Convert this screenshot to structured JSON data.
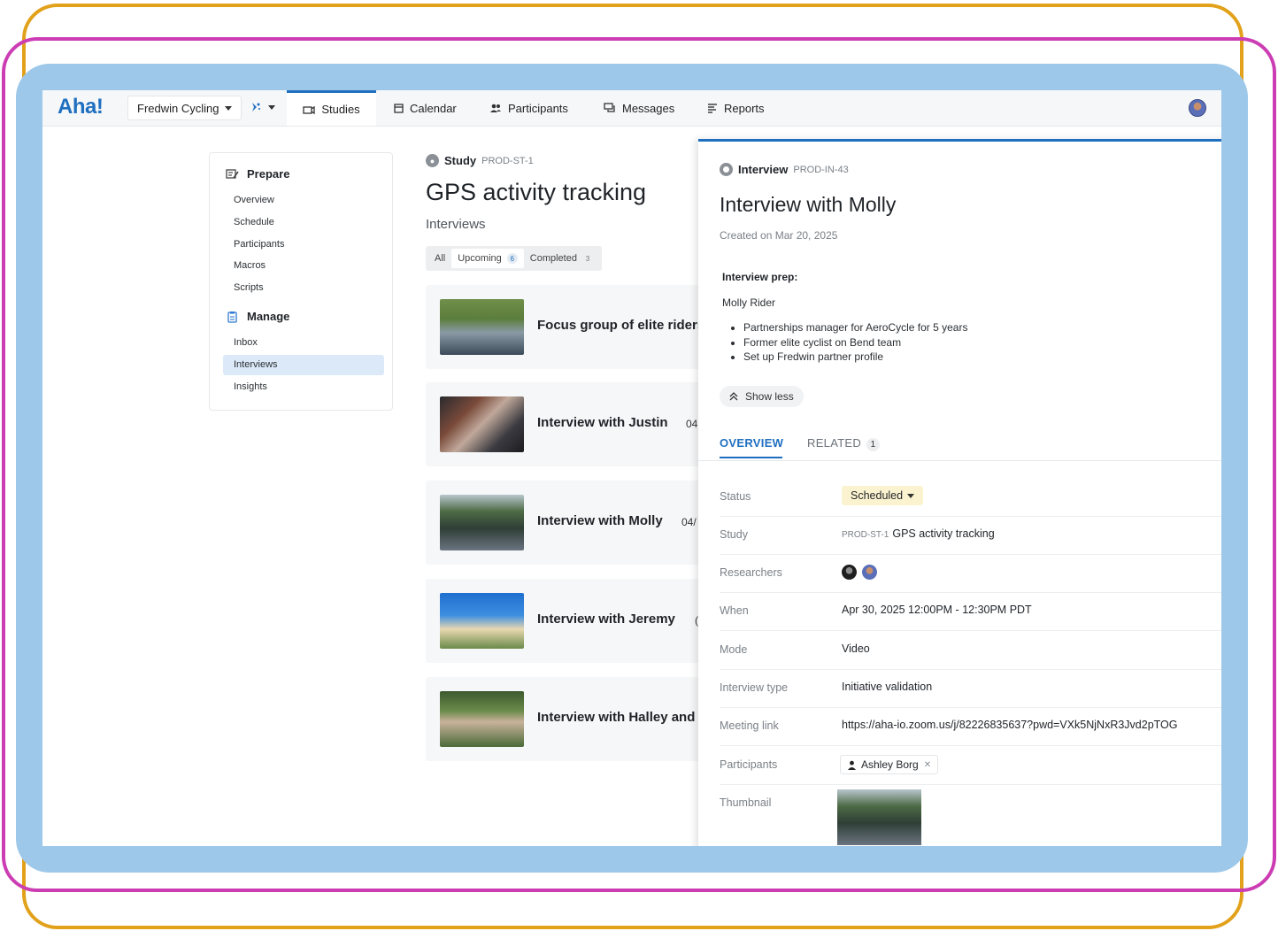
{
  "nav": {
    "logo": "Aha!",
    "workspace": "Fredwin Cycling",
    "tabs": [
      {
        "label": "Studies",
        "icon": "studies-icon",
        "active": true
      },
      {
        "label": "Calendar",
        "icon": "calendar-icon"
      },
      {
        "label": "Participants",
        "icon": "participants-icon"
      },
      {
        "label": "Messages",
        "icon": "messages-icon"
      },
      {
        "label": "Reports",
        "icon": "reports-icon"
      }
    ]
  },
  "sidebar": {
    "prepare": {
      "title": "Prepare",
      "items": [
        "Overview",
        "Schedule",
        "Participants",
        "Macros",
        "Scripts"
      ]
    },
    "manage": {
      "title": "Manage",
      "items": [
        "Inbox",
        "Interviews",
        "Insights"
      ],
      "active": "Interviews"
    }
  },
  "study": {
    "label": "Study",
    "id": "PROD-ST-1",
    "title": "GPS activity tracking",
    "section": "Interviews",
    "filters": {
      "all": "All",
      "upcoming": "Upcoming",
      "upcoming_count": "6",
      "completed": "Completed",
      "completed_count": "3"
    }
  },
  "cards": [
    {
      "title": "Focus group of elite riders",
      "date": ""
    },
    {
      "title": "Interview with Justin",
      "date": "04"
    },
    {
      "title": "Interview with Molly",
      "date": "04/"
    },
    {
      "title": "Interview with Jeremy",
      "date": "("
    },
    {
      "title": "Interview with Halley and",
      "date": ""
    }
  ],
  "panel": {
    "label": "Interview",
    "id": "PROD-IN-43",
    "title": "Interview with Molly",
    "created": "Created on Mar 20, 2025",
    "prep_title": "Interview prep:",
    "prep_name": "Molly Rider",
    "prep_points": [
      "Partnerships manager for AeroCycle for 5 years",
      "Former elite cyclist on Bend team",
      "Set up Fredwin partner profile"
    ],
    "show_less": "Show less",
    "tabs": {
      "overview": "OVERVIEW",
      "related": "RELATED",
      "related_count": "1"
    },
    "fields": {
      "status_label": "Status",
      "status_value": "Scheduled",
      "study_label": "Study",
      "study_id": "PROD-ST-1",
      "study_value": "GPS activity tracking",
      "researchers_label": "Researchers",
      "when_label": "When",
      "when_value": "Apr 30, 2025 12:00PM - 12:30PM PDT",
      "mode_label": "Mode",
      "mode_value": "Video",
      "type_label": "Interview type",
      "type_value": "Initiative validation",
      "link_label": "Meeting link",
      "link_value": "https://aha-io.zoom.us/j/82226835637?pwd=VXk5NjNxR3Jvd2pTOG",
      "participants_label": "Participants",
      "participant_name": "Ashley Borg",
      "thumbnail_label": "Thumbnail"
    }
  },
  "colors": {
    "accent": "#1f6fc0",
    "status_bg": "#fbf3cf",
    "frame_orange": "#e2a11a",
    "frame_magenta": "#cc3db4",
    "frame_blue": "#9dc8ea"
  }
}
